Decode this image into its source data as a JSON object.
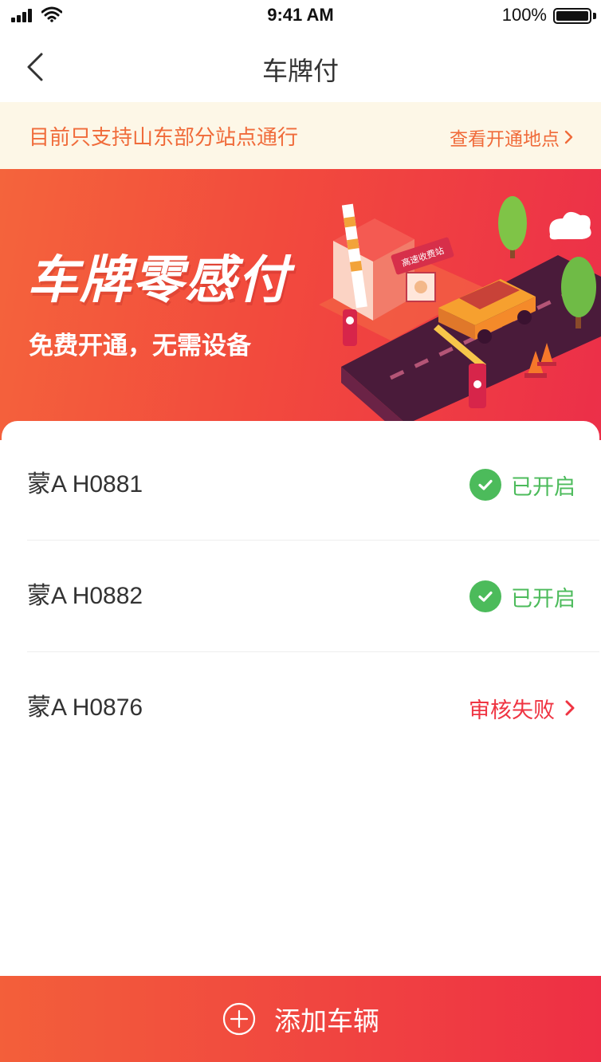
{
  "status_bar": {
    "time": "9:41 AM",
    "battery_percent": "100%"
  },
  "nav": {
    "title": "车牌付",
    "back_icon": "chevron-left-icon"
  },
  "notice": {
    "text": "目前只支持山东部分站点通行",
    "link_label": "查看开通地点",
    "link_icon": "chevron-right-icon"
  },
  "banner": {
    "title": "车牌零感付",
    "subtitle": "免费开通，无需设备",
    "toll_sign": "高速收费站"
  },
  "vehicles": [
    {
      "plate": "蒙A H0881",
      "status": "已开启",
      "status_type": "enabled",
      "status_icon": "check-circle-icon"
    },
    {
      "plate": "蒙A H0882",
      "status": "已开启",
      "status_type": "enabled",
      "status_icon": "check-circle-icon"
    },
    {
      "plate": "蒙A H0876",
      "status": "审核失败",
      "status_type": "failed",
      "status_icon": "chevron-right-icon"
    }
  ],
  "add_button": {
    "label": "添加车辆",
    "icon": "plus-circle-icon"
  },
  "colors": {
    "accent": "#f24a3d",
    "success": "#4cbb5b",
    "error": "#ef3442",
    "notice_bg": "#fdf7e7",
    "notice_text": "#f06b3a"
  }
}
